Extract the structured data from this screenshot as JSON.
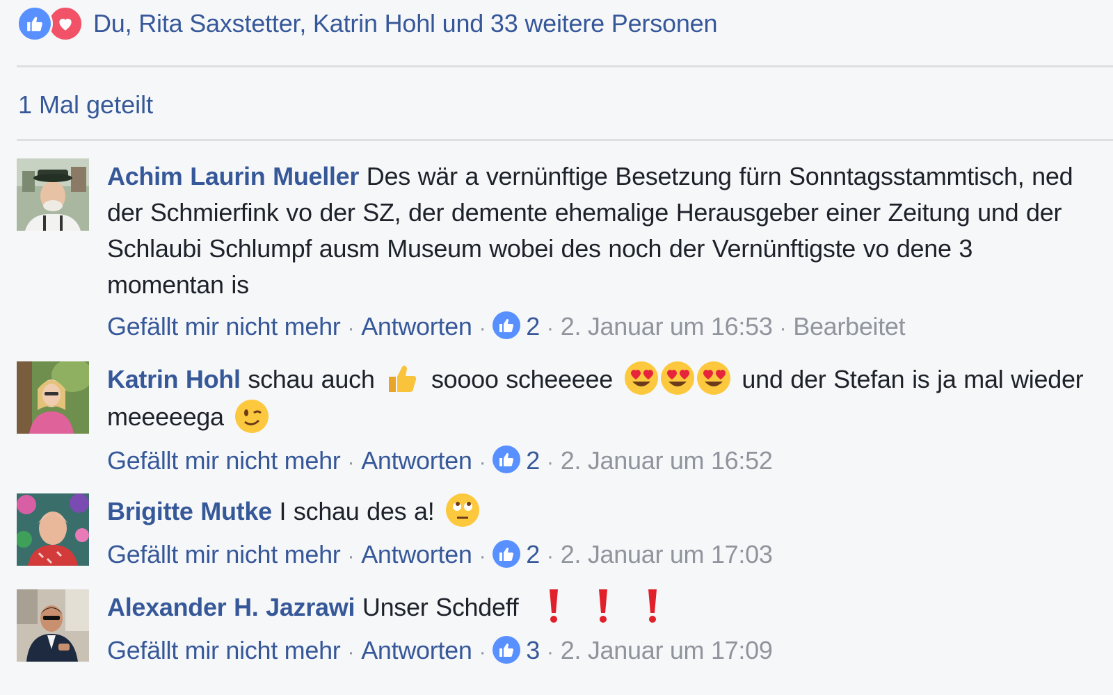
{
  "reactions": {
    "icons": [
      "like-icon",
      "love-icon"
    ],
    "text": "Du, Rita Saxstetter, Katrin Hohl und 33 weitere Personen",
    "like_color": "#5890ff",
    "love_color": "#f25268"
  },
  "shares": {
    "text": "1 Mal geteilt"
  },
  "comments": [
    {
      "author": "Achim Laurin Mueller",
      "text": "Des wär a vernünftige Besetzung fürn Sonntagsstammtisch, ned der Schmierfink vo der SZ, der demente ehemalige Herausgeber einer Zeitung und der Schlaubi Schlumpf ausm Museum wobei des noch der Vernünftigste vo dene 3 momentan is",
      "unlike": "Gefällt mir nicht mehr",
      "reply": "Antworten",
      "likes": "2",
      "time": "2. Januar um 16:53",
      "edited": "Bearbeitet"
    },
    {
      "author": "Katrin Hohl",
      "text_part1": "schau auch",
      "text_part2": "soooo scheeeee",
      "text_part3": "und der Stefan is ja mal wieder meeeeega",
      "emojis": [
        "thumbs-up-emoji",
        "heart-eyes-emoji",
        "heart-eyes-emoji",
        "heart-eyes-emoji",
        "wink-emoji"
      ],
      "unlike": "Gefällt mir nicht mehr",
      "reply": "Antworten",
      "likes": "2",
      "time": "2. Januar um 16:52"
    },
    {
      "author": "Brigitte Mutke",
      "text": "I schau des a!",
      "emojis": [
        "eye-roll-emoji"
      ],
      "unlike": "Gefällt mir nicht mehr",
      "reply": "Antworten",
      "likes": "2",
      "time": "2. Januar um 17:03"
    },
    {
      "author": "Alexander H. Jazrawi",
      "text": "Unser Schdeff",
      "emojis": [
        "exclamation-emoji",
        "exclamation-emoji",
        "exclamation-emoji"
      ],
      "unlike": "Gefällt mir nicht mehr",
      "reply": "Antworten",
      "likes": "3",
      "time": "2. Januar um 17:09"
    }
  ],
  "separator": "·"
}
